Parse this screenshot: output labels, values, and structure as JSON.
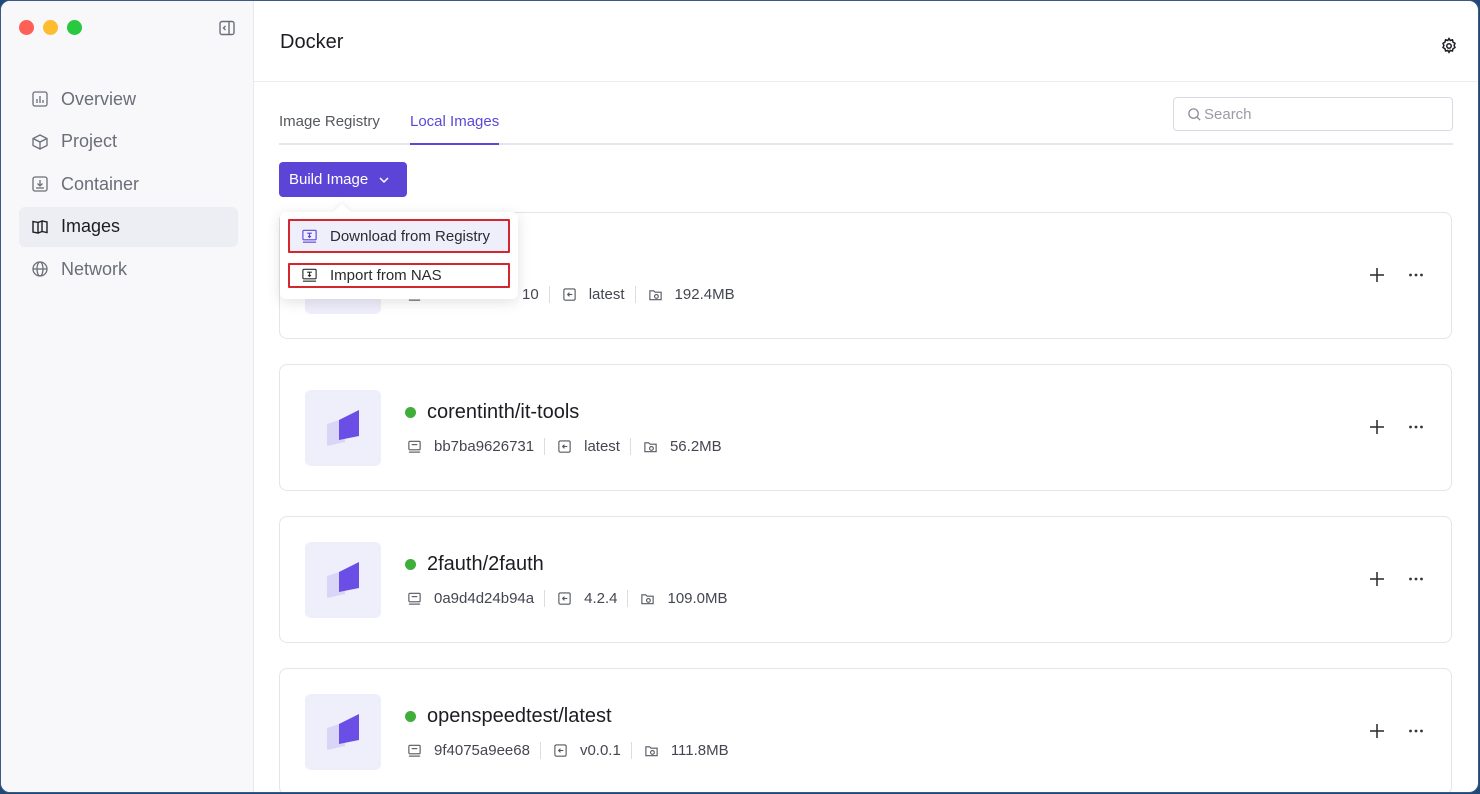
{
  "app": {
    "title": "Docker"
  },
  "colors": {
    "accent": "#5c45d6",
    "status_running": "#3fae3a",
    "highlight_box": "#d3262e"
  },
  "sidebar": {
    "items": [
      {
        "label": "Overview",
        "icon": "chart-icon",
        "active": false
      },
      {
        "label": "Project",
        "icon": "cube-icon",
        "active": false
      },
      {
        "label": "Container",
        "icon": "download-box-icon",
        "active": false
      },
      {
        "label": "Images",
        "icon": "book-icon",
        "active": true
      },
      {
        "label": "Network",
        "icon": "globe-icon",
        "active": false
      }
    ]
  },
  "tabs": [
    {
      "label": "Image Registry",
      "active": false
    },
    {
      "label": "Local Images",
      "active": true
    }
  ],
  "search": {
    "placeholder": "Search",
    "value": ""
  },
  "toolbar": {
    "build_label": "Build Image"
  },
  "dropdown": {
    "items": [
      {
        "label": "Download from Registry"
      },
      {
        "label": "Import from NAS"
      }
    ]
  },
  "images": [
    {
      "name": "",
      "id": "10",
      "tag": "latest",
      "size": "192.4MB"
    },
    {
      "name": "corentinth/it-tools",
      "id": "bb7ba9626731",
      "tag": "latest",
      "size": "56.2MB"
    },
    {
      "name": "2fauth/2fauth",
      "id": "0a9d4d24b94a",
      "tag": "4.2.4",
      "size": "109.0MB"
    },
    {
      "name": "openspeedtest/latest",
      "id": "9f4075a9ee68",
      "tag": "v0.0.1",
      "size": "111.8MB"
    }
  ]
}
